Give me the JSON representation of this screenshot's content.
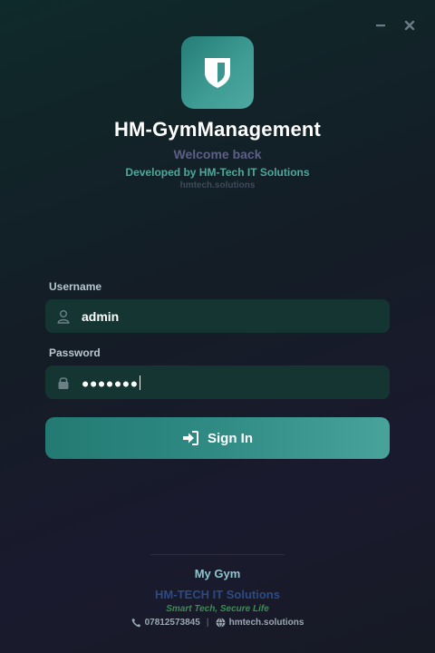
{
  "window": {
    "minimize_icon": "minimize-icon",
    "close_icon": "close-icon"
  },
  "header": {
    "logo_icon": "shield-icon",
    "title": "HM-GymManagement",
    "welcome": "Welcome back",
    "developer": "Developed by HM-Tech IT Solutions",
    "developer_site": "hmtech.solutions"
  },
  "form": {
    "username_label": "Username",
    "username_value": "admin",
    "username_icon": "user-icon",
    "password_label": "Password",
    "password_value": "●●●●●●●",
    "password_icon": "lock-icon",
    "signin_label": "Sign In",
    "signin_icon": "sign-in-icon"
  },
  "footer": {
    "gym_name": "My Gym",
    "company": "HM-TECH IT Solutions",
    "slogan": "Smart Tech, Secure Life",
    "phone": "07812573845",
    "phone_icon": "phone-icon",
    "separator": "|",
    "website": "hmtech.solutions",
    "website_icon": "globe-icon"
  },
  "colors": {
    "accent": "#3f9d95",
    "field_bg": "#143532",
    "welcome": "#5d5f86",
    "developer": "#4fa79b",
    "company": "#2c4a83",
    "slogan": "#3a8e52",
    "gym": "#8ec5ce"
  }
}
